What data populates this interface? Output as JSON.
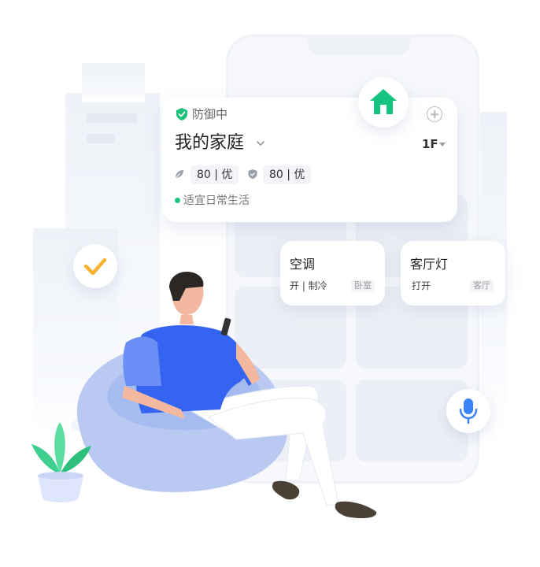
{
  "security": {
    "status": "防御中"
  },
  "home": {
    "title": "我的家庭",
    "floor": "1F"
  },
  "air": {
    "leaf_value": "80 | 优",
    "shield_value": "80 | 优"
  },
  "status": {
    "text": "适宜日常生活"
  },
  "devices": [
    {
      "name": "空调",
      "state": "开 | 制冷",
      "room": "卧室"
    },
    {
      "name": "客厅灯",
      "state": "打开",
      "room": "客厅"
    }
  ],
  "colors": {
    "accent_green": "#1ec27a",
    "accent_blue": "#3b82f6",
    "check_yellow": "#f5b331"
  },
  "icons": [
    "shield-check-icon",
    "chevron-down-icon",
    "plus-icon",
    "leaf-icon",
    "shield-icon",
    "home-icon",
    "check-icon",
    "mic-icon"
  ]
}
